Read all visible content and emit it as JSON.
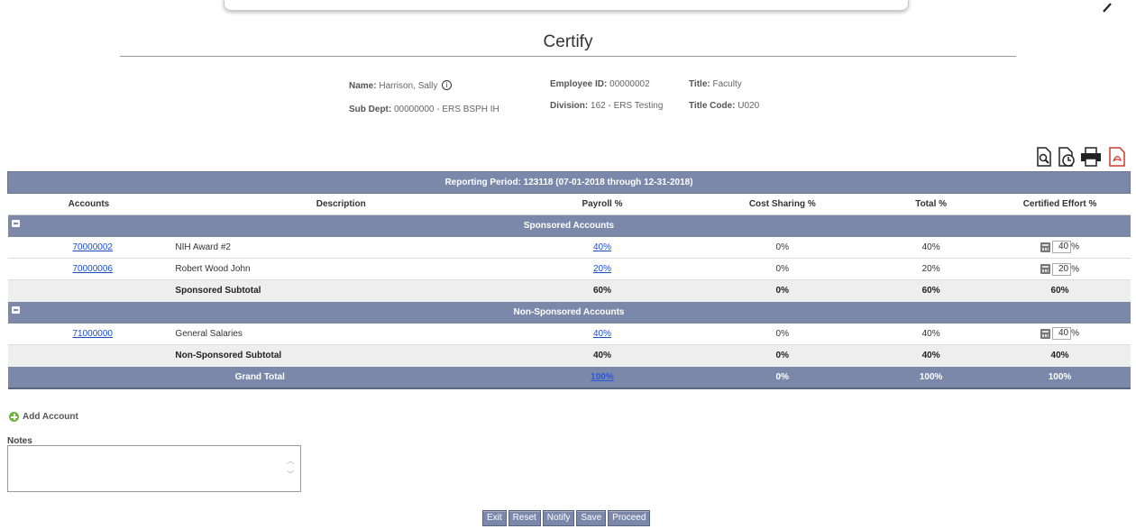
{
  "page": {
    "title": "Certify"
  },
  "employee": {
    "name_label": "Name:",
    "name": "Harrison, Sally",
    "subdept_label": "Sub Dept:",
    "subdept": "00000000 - ERS BSPH IH",
    "empid_label": "Employee ID:",
    "empid": "00000002",
    "division_label": "Division:",
    "division": "162 - ERS Testing",
    "title_label": "Title:",
    "title": "Faculty",
    "titlecode_label": "Title Code:",
    "titlecode": "U020"
  },
  "toolbar": {
    "icons": [
      "preview-icon",
      "history-icon",
      "print-icon",
      "pdf-icon"
    ]
  },
  "table": {
    "period_label": "Reporting Period:",
    "period_value": "123118 (07-01-2018 through 12-31-2018)",
    "headers": {
      "accounts": "Accounts",
      "description": "Description",
      "payroll": "Payroll %",
      "cost_sharing": "Cost Sharing %",
      "total": "Total %",
      "certified": "Certified Effort %"
    },
    "sponsored": {
      "title": "Sponsored Accounts",
      "rows": [
        {
          "account": "70000002",
          "description": "NIH Award #2",
          "payroll": "40%",
          "cost_sharing": "0%",
          "total": "40%",
          "certified": "40",
          "pct": "%"
        },
        {
          "account": "70000006",
          "description": "Robert Wood John",
          "payroll": "20%",
          "cost_sharing": "0%",
          "total": "20%",
          "certified": "20",
          "pct": "%"
        }
      ],
      "subtotal": {
        "label": "Sponsored Subtotal",
        "payroll": "60%",
        "cost_sharing": "0%",
        "total": "60%",
        "certified": "60%"
      }
    },
    "nonsponsored": {
      "title": "Non-Sponsored Accounts",
      "rows": [
        {
          "account": "71000000",
          "description": "General Salaries",
          "payroll": "40%",
          "cost_sharing": "0%",
          "total": "40%",
          "certified": "40",
          "pct": "%"
        }
      ],
      "subtotal": {
        "label": "Non-Sponsored Subtotal",
        "payroll": "40%",
        "cost_sharing": "0%",
        "total": "40%",
        "certified": "40%"
      }
    },
    "grand": {
      "label": "Grand Total",
      "payroll": "100%",
      "cost_sharing": "0%",
      "total": "100%",
      "certified": "100%"
    }
  },
  "add_account": "Add Account",
  "notes": {
    "label": "Notes",
    "value": ""
  },
  "buttons": {
    "exit": "Exit",
    "reset": "Reset",
    "notify": "Notify",
    "save": "Save",
    "proceed": "Proceed"
  }
}
